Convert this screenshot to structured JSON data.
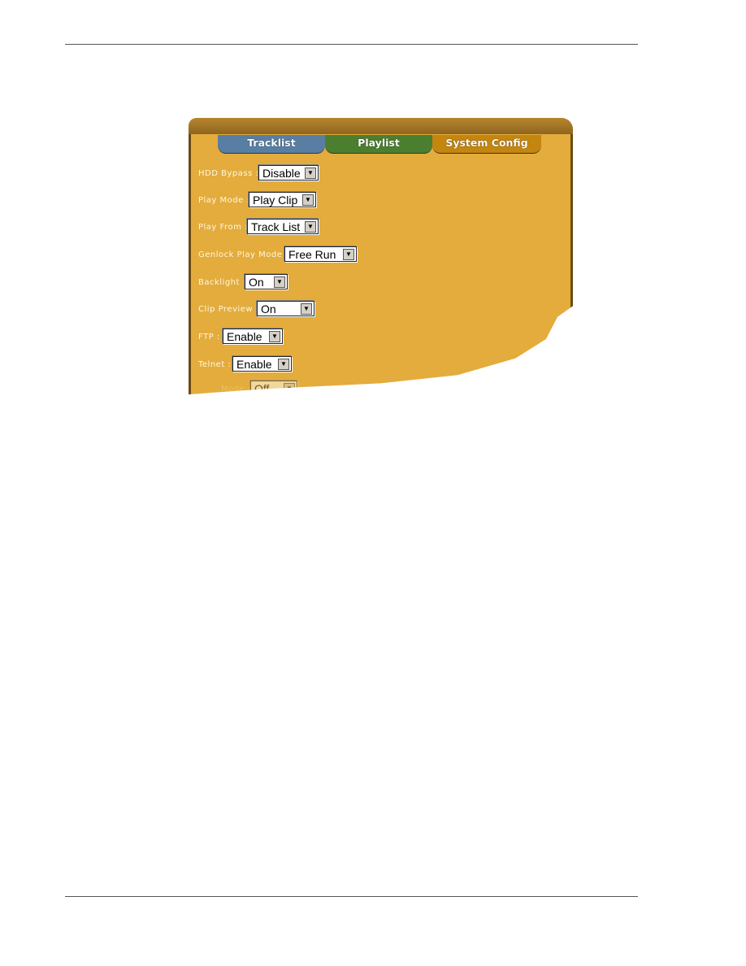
{
  "tabs": [
    {
      "label": "Tracklist",
      "color": "#587fa3"
    },
    {
      "label": "Playlist",
      "color": "#4b7e2f"
    },
    {
      "label": "System Config",
      "color": "#c4860f"
    }
  ],
  "fields": [
    {
      "label": "HDD Bypass :",
      "value": "Disable"
    },
    {
      "label": "Play Mode :",
      "value": "Play Clip"
    },
    {
      "label": "Play From :",
      "value": "Track List"
    },
    {
      "label": "Genlock Play Mode :",
      "value": "Free Run"
    },
    {
      "label": "Backlight :",
      "value": "On"
    },
    {
      "label": "Clip Preview :",
      "value": "On"
    },
    {
      "label": "FTP :",
      "value": "Enable"
    },
    {
      "label": "Telnet :",
      "value": "Enable"
    },
    {
      "label": "Mode :",
      "value": "Off"
    }
  ],
  "icons": {
    "dropdown": "chevron-down-icon"
  }
}
